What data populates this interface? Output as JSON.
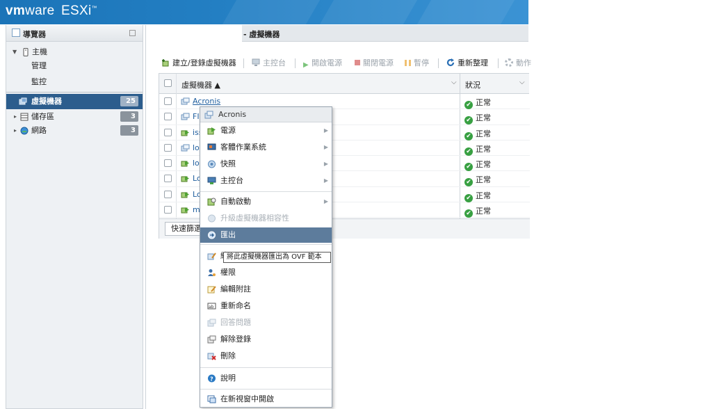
{
  "header": {
    "brand_vm": "vm",
    "brand_ware": "ware",
    "brand_product": "ESXi",
    "tm": "™"
  },
  "navigator": {
    "title": "導覽器",
    "items": [
      {
        "label": "主機"
      },
      {
        "label": "管理"
      },
      {
        "label": "監控"
      },
      {
        "label": "虛擬機器",
        "count": "25"
      },
      {
        "label": "儲存區",
        "count": "3"
      },
      {
        "label": "網路",
        "count": "3"
      }
    ]
  },
  "content": {
    "title": "- 虛擬機器",
    "toolbar": {
      "create": "建立/登錄虛擬機器",
      "console": "主控台",
      "power_on": "開啟電源",
      "power_off": "關閉電源",
      "suspend": "暫停",
      "refresh": "重新整理",
      "actions": "動作"
    },
    "grid": {
      "col_name": "虛擬機器 ▲",
      "col_status": "狀況",
      "rows": [
        {
          "name": "Acronis",
          "status": "正常"
        },
        {
          "name": "FI",
          "status": "正常"
        },
        {
          "name": "iss",
          "status": "正常"
        },
        {
          "name": "loc",
          "status": "正常"
        },
        {
          "name": "loc",
          "status": "正常"
        },
        {
          "name": "Lo",
          "status": "正常"
        },
        {
          "name": "Lo",
          "status": "正常"
        },
        {
          "name": "ma",
          "status": "正常"
        }
      ],
      "quick_filter": "快速篩選"
    }
  },
  "context_menu": {
    "title": "Acronis",
    "items": {
      "power": "電源",
      "guest_os": "客體作業系統",
      "snapshots": "快照",
      "console": "主控台",
      "autostart": "自動啟動",
      "upgrade": "升級虛擬機器相容性",
      "export": "匯出",
      "edit_settings": "編",
      "permissions": "權限",
      "edit_notes": "編輯附註",
      "rename": "重新命名",
      "answer": "回答問題",
      "unregister": "解除登錄",
      "delete": "刪除",
      "help": "說明",
      "new_window": "在新視窗中開啟"
    },
    "tooltip": "將此虛擬機器匯出為 OVF 範本"
  },
  "colors": {
    "header_blue": "#1b74b8",
    "selected_nav": "#2c5d8d",
    "menu_highlight": "#5d7c9c",
    "ok_green": "#38a042",
    "link_blue": "#1f5e9e"
  }
}
